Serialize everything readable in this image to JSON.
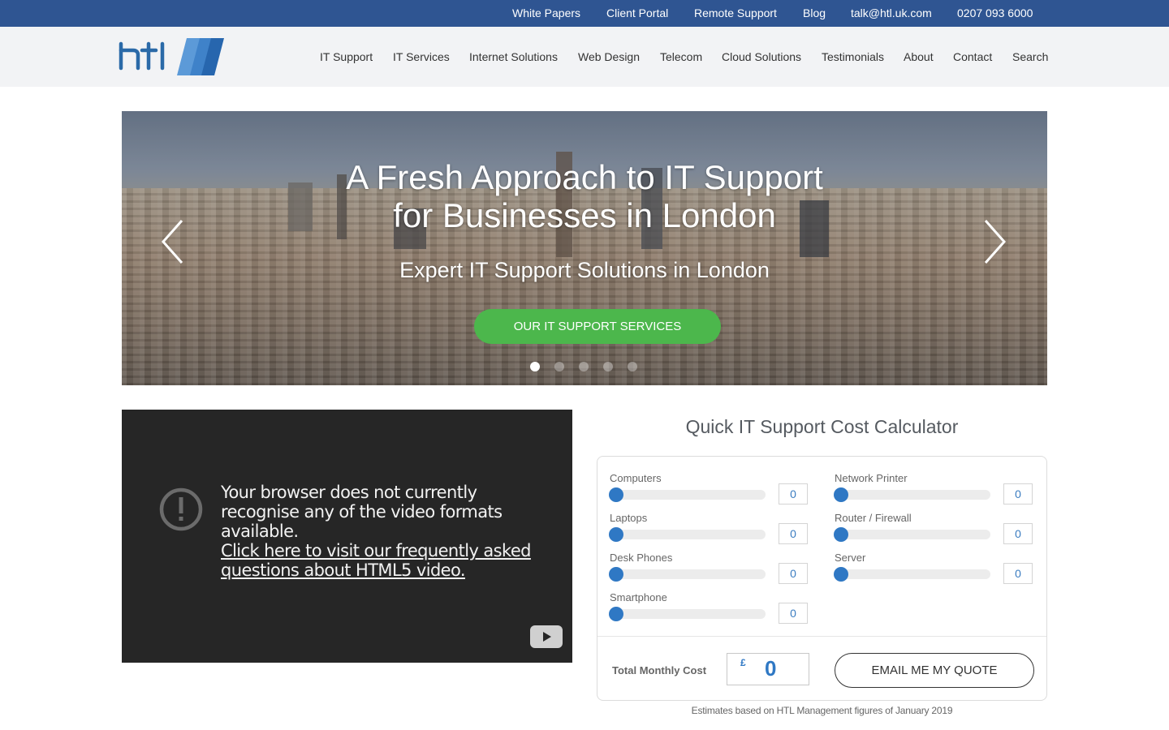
{
  "topbar": {
    "links": [
      "White Papers",
      "Client Portal",
      "Remote Support",
      "Blog",
      "talk@htl.uk.com",
      "0207 093 6000"
    ],
    "bg_color": "#2f5592"
  },
  "header": {
    "logo_text": "htl",
    "nav": [
      "IT Support",
      "IT Services",
      "Internet Solutions",
      "Web Design",
      "Telecom",
      "Cloud Solutions",
      "Testimonials",
      "About",
      "Contact",
      "Search"
    ]
  },
  "hero": {
    "title_line1": "A Fresh Approach to IT Support",
    "title_line2": "for Businesses in London",
    "subtitle": "Expert IT Support Solutions in London",
    "button_label": "OUR IT SUPPORT SERVICES",
    "button_color": "#4cb74c",
    "slides_count": 5,
    "active_slide": 1,
    "prev_icon": "chevron-left-icon",
    "next_icon": "chevron-right-icon"
  },
  "video": {
    "message": "Your browser does not currently recognise any of the video formats available.",
    "link_text": "Click here to visit our frequently asked questions about HTML5 video.",
    "warning_icon": "exclamation-circle-icon",
    "play_icon": "youtube-play-icon"
  },
  "calculator": {
    "title": "Quick IT Support Cost Calculator",
    "fields_left": [
      {
        "label": "Computers",
        "value": "0"
      },
      {
        "label": "Laptops",
        "value": "0"
      },
      {
        "label": "Desk Phones",
        "value": "0"
      },
      {
        "label": "Smartphone",
        "value": "0"
      }
    ],
    "fields_right": [
      {
        "label": "Network Printer",
        "value": "0"
      },
      {
        "label": "Router / Firewall",
        "value": "0"
      },
      {
        "label": "Server",
        "value": "0"
      }
    ],
    "total_label": "Total Monthly Cost",
    "currency": "£",
    "total_value": "0",
    "email_button": "EMAIL ME MY QUOTE",
    "note": "Estimates based on HTL Management figures of January 2019",
    "accent_color": "#2f78c4"
  }
}
